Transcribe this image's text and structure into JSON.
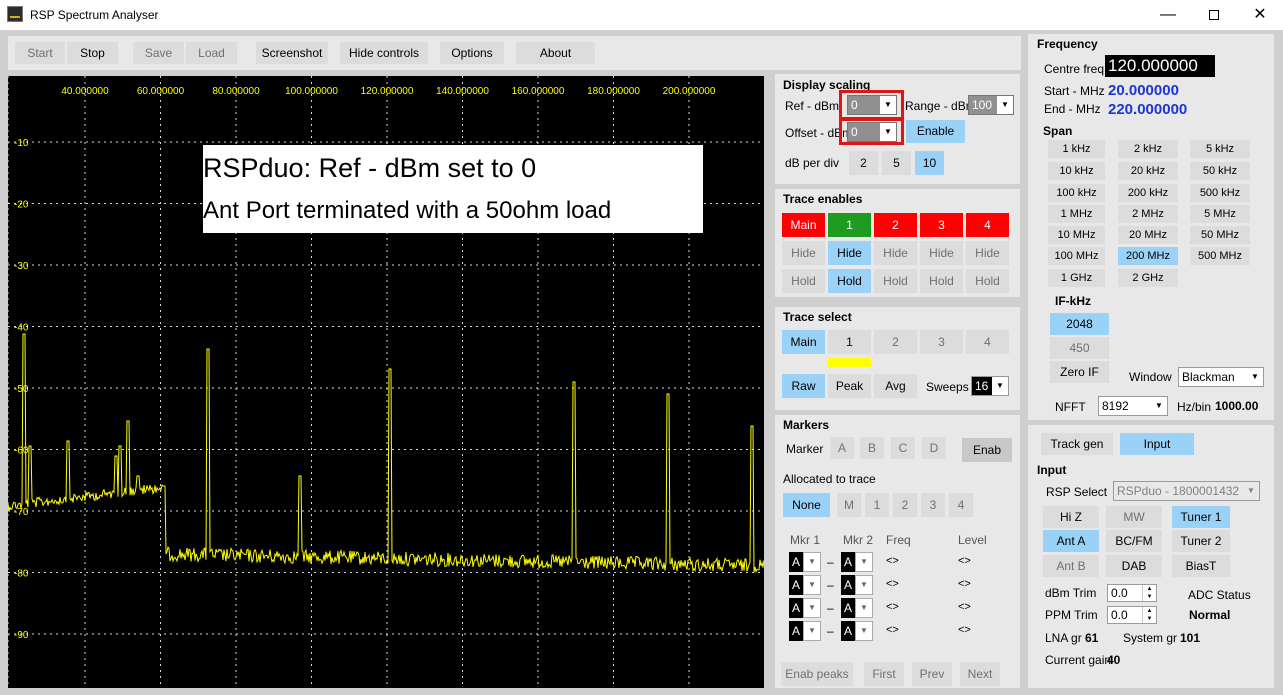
{
  "window": {
    "title": "RSP Spectrum Analyser"
  },
  "toolbar": {
    "start": "Start",
    "stop": "Stop",
    "save": "Save",
    "load": "Load",
    "screenshot": "Screenshot",
    "hide_controls": "Hide controls",
    "options": "Options",
    "about": "About"
  },
  "spectrum": {
    "x_ticks": [
      "40.000000",
      "60.000000",
      "80.000000",
      "100.000000",
      "120.000000",
      "140.000000",
      "160.000000",
      "180.000000",
      "200.000000"
    ],
    "y_ticks": [
      "-10",
      "-20",
      "-30",
      "-40",
      "-50",
      "-60",
      "-70",
      "-80",
      "-90"
    ],
    "trace_color": "#ffff00",
    "annotation": {
      "line1": "RSPduo: Ref - dBm set to 0",
      "line2": "Ant Port terminated with a 50ohm load"
    }
  },
  "display_scaling": {
    "title": "Display scaling",
    "ref_label": "Ref - dBm",
    "ref_value": "0",
    "range_label": "Range - dBm",
    "range_value": "100",
    "offset_label": "Offset - dBm",
    "offset_value": "0",
    "enable": "Enable",
    "db_per_div_label": "dB per div",
    "db_options": [
      "2",
      "5",
      "10"
    ]
  },
  "trace_enables": {
    "title": "Trace enables",
    "traces": [
      "Main",
      "1",
      "2",
      "3",
      "4"
    ],
    "hide": "Hide",
    "hold": "Hold"
  },
  "trace_select": {
    "title": "Trace select",
    "traces": [
      "Main",
      "1",
      "2",
      "3",
      "4"
    ],
    "raw": "Raw",
    "peak": "Peak",
    "avg": "Avg",
    "sweeps_label": "Sweeps",
    "sweeps_value": "16"
  },
  "markers": {
    "title": "Markers",
    "marker_label": "Marker",
    "letters": [
      "A",
      "B",
      "C",
      "D"
    ],
    "enab": "Enab",
    "allocated_label": "Allocated to trace",
    "alloc_options": [
      "None",
      "M",
      "1",
      "2",
      "3",
      "4"
    ],
    "mkr1_label": "Mkr 1",
    "mkr2_label": "Mkr 2",
    "freq_label": "Freq",
    "level_label": "Level",
    "row_value": "A",
    "dash": "–",
    "diamond": "<>",
    "enab_peaks": "Enab peaks",
    "first": "First",
    "prev": "Prev",
    "next": "Next"
  },
  "frequency": {
    "title": "Frequency",
    "centre_label": "Centre freq",
    "centre_value": "120.000000",
    "start_label": "Start - MHz",
    "start_value": "20.000000",
    "end_label": "End - MHz",
    "end_value": "220.000000",
    "span_label": "Span",
    "span_options": [
      "1 kHz",
      "2 kHz",
      "5 kHz",
      "10 kHz",
      "20 kHz",
      "50 kHz",
      "100 kHz",
      "200 kHz",
      "500 kHz",
      "1 MHz",
      "2 MHz",
      "5 MHz",
      "10 MHz",
      "20 MHz",
      "50 MHz",
      "100 MHz",
      "200 MHz",
      "500 MHz",
      "1 GHz",
      "2 GHz"
    ],
    "if_label": "IF-kHz",
    "if_options": [
      "2048",
      "450",
      "Zero IF"
    ],
    "window_label": "Window",
    "window_value": "Blackman",
    "nfft_label": "NFFT",
    "nfft_value": "8192",
    "hzbin_label": "Hz/bin",
    "hzbin_value": "1000.00"
  },
  "input": {
    "track_gen": "Track gen",
    "input_tab": "Input",
    "title": "Input",
    "rsp_select_label": "RSP Select",
    "rsp_select_value": "RSPduo - 1800001432",
    "hiz": "Hi Z",
    "mw": "MW",
    "tuner1": "Tuner 1",
    "ant_a": "Ant A",
    "bcfm": "BC/FM",
    "tuner2": "Tuner 2",
    "ant_b": "Ant B",
    "dab": "DAB",
    "biast": "BiasT",
    "dbm_trim_label": "dBm Trim",
    "dbm_trim_value": "0.0",
    "ppm_trim_label": "PPM Trim",
    "ppm_trim_value": "0.0",
    "adc_status_label": "ADC Status",
    "adc_status_value": "Normal",
    "lna_label": "LNA gr",
    "lna_value": "61",
    "system_label": "System gr",
    "system_value": "101",
    "current_label": "Current gain",
    "current_value": "40"
  }
}
